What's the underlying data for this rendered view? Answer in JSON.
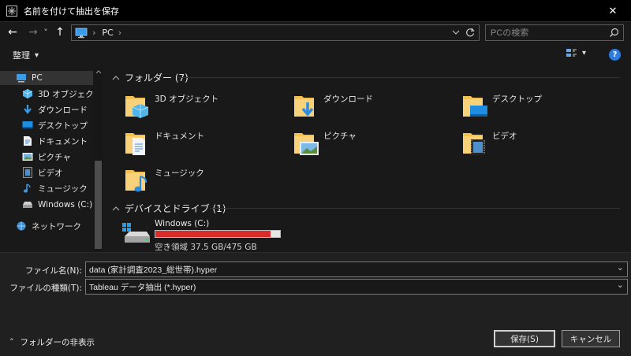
{
  "window": {
    "title": "名前を付けて抽出を保存",
    "close_glyph": "✕"
  },
  "nav": {
    "back_glyph": "←",
    "forward_glyph": "→",
    "recent_glyph": "˅",
    "up_glyph": "↑",
    "breadcrumb": [
      "PC"
    ],
    "breadcrumb_sep": "›",
    "search_placeholder": "PCの検索"
  },
  "toolbar": {
    "organize_label": "整理",
    "organize_caret": "▾",
    "view_caret": "▾",
    "help_glyph": "?"
  },
  "sidebar": {
    "items": [
      {
        "label": "PC",
        "icon": "pc-icon"
      },
      {
        "label": "3D オブジェクト",
        "icon": "3d-objects-icon"
      },
      {
        "label": "ダウンロード",
        "icon": "download-icon"
      },
      {
        "label": "デスクトップ",
        "icon": "desktop-icon"
      },
      {
        "label": "ドキュメント",
        "icon": "documents-icon"
      },
      {
        "label": "ピクチャ",
        "icon": "pictures-icon"
      },
      {
        "label": "ビデオ",
        "icon": "videos-icon"
      },
      {
        "label": "ミュージック",
        "icon": "music-icon"
      },
      {
        "label": "Windows (C:)",
        "icon": "drive-icon"
      },
      {
        "label": "ネットワーク",
        "icon": "network-icon"
      }
    ]
  },
  "content": {
    "folders_header": "フォルダー (7)",
    "folders": [
      {
        "name": "3D オブジェクト",
        "icon": "3d-objects-icon"
      },
      {
        "name": "ダウンロード",
        "icon": "download-icon"
      },
      {
        "name": "デスクトップ",
        "icon": "desktop-icon"
      },
      {
        "name": "ドキュメント",
        "icon": "documents-icon"
      },
      {
        "name": "ピクチャ",
        "icon": "pictures-icon"
      },
      {
        "name": "ビデオ",
        "icon": "videos-icon"
      },
      {
        "name": "ミュージック",
        "icon": "music-icon"
      }
    ],
    "drives_header": "デバイスとドライブ (1)",
    "drive": {
      "name": "Windows (C:)",
      "space": "空き領域 37.5 GB/475 GB",
      "used_fraction": 0.921
    }
  },
  "form": {
    "filename_label": "ファイル名(N):",
    "filename_value": "data (家計調査2023_総世帯).hyper",
    "filetype_label": "ファイルの種類(T):",
    "filetype_value": "Tableau データ抽出 (*.hyper)",
    "dropdown_glyph": "⌄"
  },
  "footer": {
    "hide_folders_label": "フォルダーの非表示",
    "hide_folders_glyph": "˄",
    "save_label": "保存(S)",
    "cancel_label": "キャンセル"
  },
  "colors": {
    "accent": "#2e7be0",
    "folder": "#f3c14c",
    "drive_bar": "#da2b2b"
  }
}
